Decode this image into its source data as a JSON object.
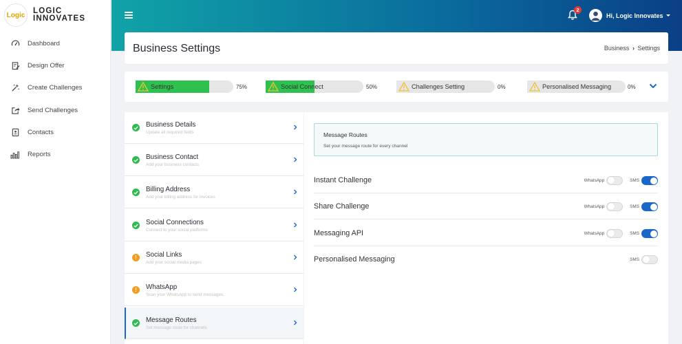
{
  "brand": {
    "logo_text": "Logic",
    "logo_tagline": "innovates",
    "name_line1": "LOGIC",
    "name_line2": "INNOVATES"
  },
  "sidebar": {
    "items": [
      {
        "label": "Dashboard",
        "icon": "speedometer-icon"
      },
      {
        "label": "Design Offer",
        "icon": "edit-document-icon"
      },
      {
        "label": "Create Challenges",
        "icon": "magic-wand-icon"
      },
      {
        "label": "Send Challenges",
        "icon": "share-icon"
      },
      {
        "label": "Contacts",
        "icon": "contact-card-icon"
      },
      {
        "label": "Reports",
        "icon": "bar-chart-icon"
      }
    ]
  },
  "header": {
    "notification_count": "2",
    "user_greeting": "Hi, Logic Innovates"
  },
  "page": {
    "title": "Business Settings",
    "breadcrumb_parent": "Business",
    "breadcrumb_sep": "›",
    "breadcrumb_current": "Settings"
  },
  "progress": [
    {
      "label": "Settings",
      "percent_text": "75%",
      "value": 0.75
    },
    {
      "label": "Social Connect",
      "percent_text": "50%",
      "value": 0.5
    },
    {
      "label": "Challenges Setting",
      "percent_text": "0%",
      "value": 0
    },
    {
      "label": "Personalised Messaging",
      "percent_text": "0%",
      "value": 0
    }
  ],
  "settings_list": [
    {
      "title": "Business Details",
      "subtitle": "Update all required fields",
      "status": "complete"
    },
    {
      "title": "Business Contact",
      "subtitle": "Add your business contacts",
      "status": "complete"
    },
    {
      "title": "Billing Address",
      "subtitle": "Add your billing address for invoices",
      "status": "complete"
    },
    {
      "title": "Social Connections",
      "subtitle": "Connect to your social platforms",
      "status": "complete"
    },
    {
      "title": "Social Links",
      "subtitle": "Add your social media pages",
      "status": "pending"
    },
    {
      "title": "WhatsApp",
      "subtitle": "Scan your WhatsApp to send messages.",
      "status": "pending"
    },
    {
      "title": "Message Routes",
      "subtitle": "Set message route for channels",
      "status": "complete"
    }
  ],
  "message_routes": {
    "info_title": "Message Routes",
    "info_subtitle": "Set your message route for every channel",
    "rows": [
      {
        "title": "Instant Challenge",
        "whatsapp_label": "WhatsApp",
        "whatsapp_on": false,
        "sms_label": "SMS",
        "sms_on": true
      },
      {
        "title": "Share Challenge",
        "whatsapp_label": "WhatsApp",
        "whatsapp_on": false,
        "sms_label": "SMS",
        "sms_on": true
      },
      {
        "title": "Messaging API",
        "whatsapp_label": "WhatsApp",
        "whatsapp_on": false,
        "sms_label": "SMS",
        "sms_on": true
      },
      {
        "title": "Personalised Messaging",
        "sms_label": "SMS",
        "sms_on": false
      }
    ]
  },
  "colors": {
    "header_gradient_start": "#10a3a7",
    "header_gradient_end": "#0a3f86",
    "progress_fill": "#2ec14f",
    "toggle_on": "#1b67c9",
    "complete": "#2ebb52",
    "pending": "#f59b1d",
    "warning": "#f2c230"
  }
}
